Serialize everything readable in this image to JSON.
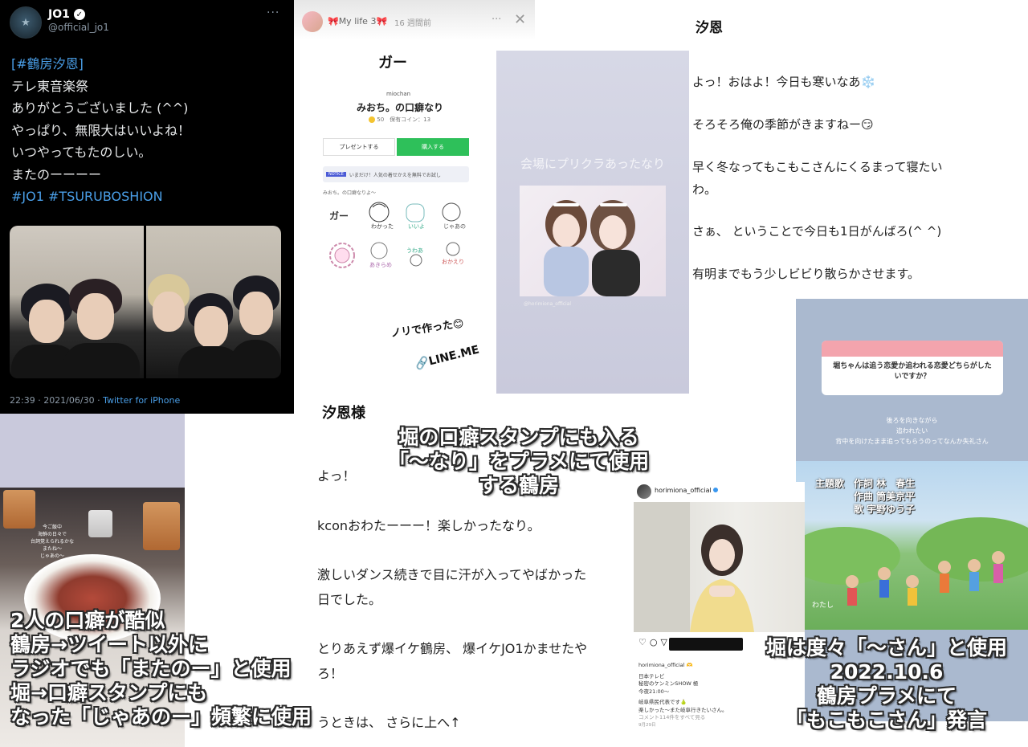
{
  "tweet": {
    "display_name": "JO1",
    "handle": "@official_jo1",
    "more": "···",
    "hashtag_line": "[#鶴房汐恩]",
    "lines": [
      "テレ東音楽祭",
      "ありがとうございました (^^)",
      "やっぱり、無限大はいいよね！",
      "いつやってもたのしい。",
      "またのーーーー"
    ],
    "tags": "#JO1 #TSURUBOSHION",
    "timestamp": "22:39 · 2021/06/30 · ",
    "source": "Twitter for iPhone"
  },
  "story": {
    "title": "🎀My life 3🎀",
    "time": "16 週間前",
    "heading": "ガー",
    "creator": "miochan",
    "sticker_name": "みおち。の口癖なり",
    "coin": "50",
    "coin_label": "保有コイン：13",
    "gift_button": "プレゼントする",
    "buy_button": "購入する",
    "notice_tag": "NOTICE",
    "notice_text": "いまだけ！人気の着せかえを無料でお試し",
    "preview_label": "みおち。の口癖なりよ〜",
    "stickers": [
      "ガー",
      "わかった",
      "いいよ",
      "じゃあの",
      "ぴえん",
      "あきらめ",
      "うわあ",
      "おかえり"
    ],
    "footer": "ノリで作った😊",
    "link": "🔗LINE.ME"
  },
  "puri": {
    "caption": "会場にプリクラあったなり",
    "tag": "@horimiona_official"
  },
  "note1": {
    "heading": "汐恩",
    "lines": [
      "よっ！おはよ！今日も寒いなあ❄️",
      "そろそろ俺の季節がきますねー😏",
      "早く冬なってもこもこさんにくるまって寝たい",
      "わ。",
      "さぁ、 ということで今日も1日がんばろ(^ ^)",
      "有明までもう少しビビり散らかさせます。"
    ]
  },
  "qstory": {
    "question": "堀ちゃんは追う恋愛か追われる恋愛どちらがしたいですか？",
    "answer": [
      "後ろを向きながら",
      "追われたい",
      "背中を向けたまま追ってもらうのってなんか失礼さん"
    ],
    "credits": [
      "主題歌　作詞 林　春生",
      "　　　　作曲 筒美京平",
      "　　　　歌 宇野ゆう子"
    ],
    "watashi": "わたし"
  },
  "food": {
    "story_text": "今ご飯中\n海鮮の日々で\n台詞覚えられるかな\nまたね〜\nじゃあの〜"
  },
  "note2": {
    "heading": "汐恩様",
    "lines": [
      "よっ！",
      "kconおわたーーー！楽しかったなり。",
      "激しいダンス続きで目に汗が入ってやばかった",
      "日でした。",
      "とりあえず爆イケ鶴房、 爆イケJO1かませたや",
      "ろ！",
      "うときは、 さらに上へ↑"
    ]
  },
  "ig": {
    "account": "horimiona_official",
    "icons": "♡○▽",
    "caption_lines": [
      "horimiona_official 🫶",
      "日本テレビ",
      "秘密のケンミンSHOW 極",
      "今夜21:00〜",
      "岐阜県民代表です🍐",
      "楽しかった〜また岐阜行きたいさん。",
      "コメント114件をすべて見る",
      "9月29日"
    ]
  },
  "overlays": {
    "mid": [
      "堀の口癖スタンプにも入る",
      "「〜なり」をプラメにて使用",
      "する鶴房"
    ],
    "left": [
      "2人の口癖が酷似",
      "鶴房→ツイート以外に",
      "ラジオでも「またのー」と使用",
      "堀→口癖スタンプにも",
      "なった「じゃあのー」頻繁に使用"
    ],
    "right": [
      "堀は度々「〜さん」と使用",
      "2022.10.6",
      "鶴房プラメにて",
      "「もこもこさん」発言"
    ]
  }
}
